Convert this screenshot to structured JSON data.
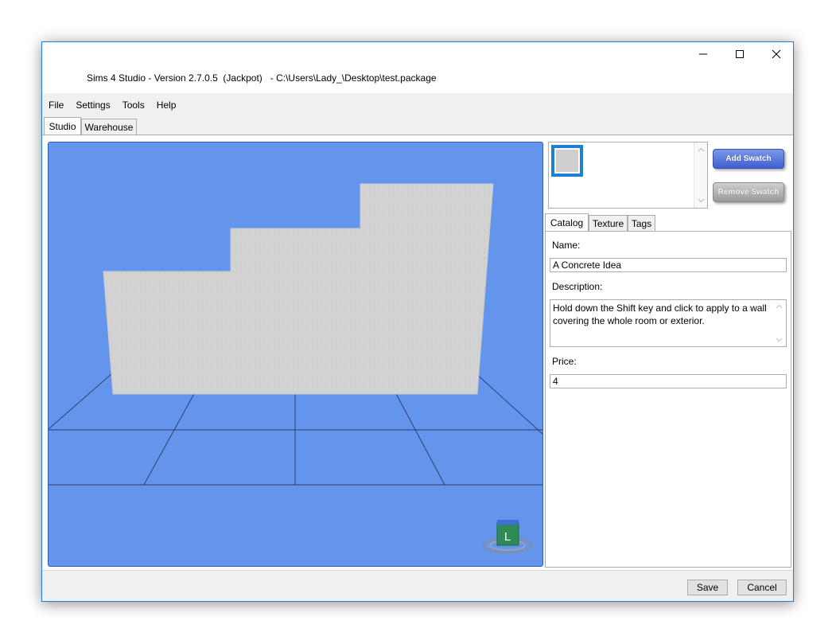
{
  "window": {
    "title": "Sims 4 Studio - Version 2.7.0.5  (Jackpot)   - C:\\Users\\Lady_\\Desktop\\test.package"
  },
  "menu": {
    "items": [
      {
        "label": "File"
      },
      {
        "label": "Settings"
      },
      {
        "label": "Tools"
      },
      {
        "label": "Help"
      }
    ]
  },
  "main_tabs": [
    {
      "label": "Studio",
      "active": true
    },
    {
      "label": "Warehouse",
      "active": false
    }
  ],
  "viewport": {
    "background_color": "#6495ed",
    "gizmo_label": "L"
  },
  "swatches": {
    "add_label": "Add Swatch",
    "remove_label": "Remove Swatch",
    "selected_color": "#cfcfcf"
  },
  "sub_tabs": [
    {
      "label": "Catalog",
      "active": true
    },
    {
      "label": "Texture",
      "active": false
    },
    {
      "label": "Tags",
      "active": false
    }
  ],
  "catalog": {
    "name_label": "Name:",
    "name_value": "A Concrete Idea",
    "description_label": "Description:",
    "description_value": "Hold down the Shift key and click to apply to a wall covering the whole room or exterior.",
    "price_label": "Price:",
    "price_value": "4"
  },
  "footer": {
    "save_label": "Save",
    "cancel_label": "Cancel"
  },
  "colors": {
    "accent": "#1e7fd6",
    "add_button": "#4e6fdc",
    "remove_button": "#a9a9a9"
  }
}
